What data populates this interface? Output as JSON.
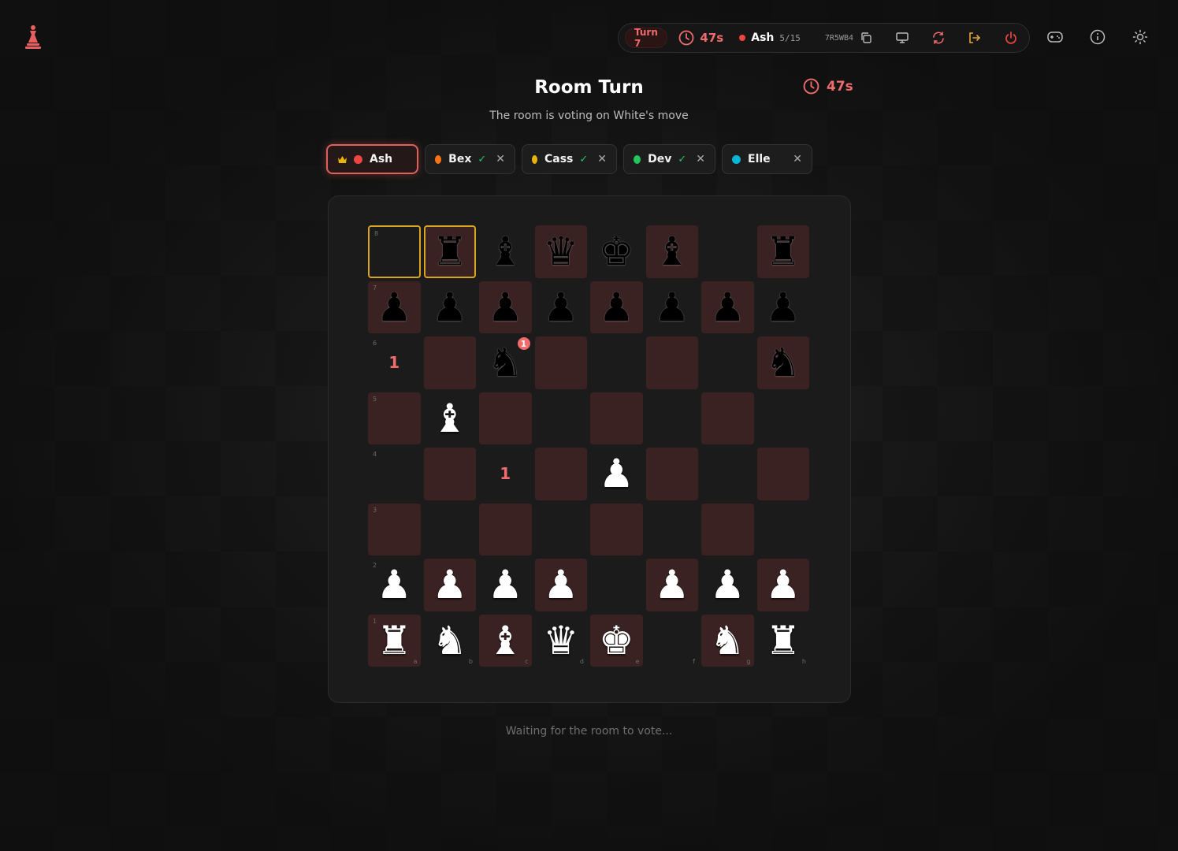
{
  "topbar": {
    "turn_label": "Turn 7",
    "timer": "47s",
    "current_player": "Ash",
    "player_count": "5/15",
    "room_code": "7R5WB4"
  },
  "header": {
    "title": "Room Turn",
    "subtitle": "The room is voting on White's move",
    "timer": "47s"
  },
  "players": [
    {
      "name": "Ash",
      "color": "#ef4444",
      "active": true,
      "leader": true,
      "voted": false,
      "removable": false
    },
    {
      "name": "Bex",
      "color": "#f97316",
      "active": false,
      "leader": false,
      "voted": true,
      "removable": true
    },
    {
      "name": "Cass",
      "color": "#eab308",
      "active": false,
      "leader": false,
      "voted": true,
      "removable": true
    },
    {
      "name": "Dev",
      "color": "#22c55e",
      "active": false,
      "leader": false,
      "voted": true,
      "removable": true
    },
    {
      "name": "Elle",
      "color": "#06b6d4",
      "active": false,
      "leader": false,
      "voted": false,
      "removable": true
    }
  ],
  "board": {
    "rank_labels": [
      "8",
      "7",
      "6",
      "5",
      "4",
      "3",
      "2",
      "1"
    ],
    "file_labels": [
      "a",
      "b",
      "c",
      "d",
      "e",
      "f",
      "g",
      "h"
    ],
    "rows": [
      [
        "",
        "r",
        "b",
        "q",
        "k",
        "b",
        "",
        "r"
      ],
      [
        "p",
        "p",
        "p",
        "p",
        "p",
        "p",
        "p",
        "p"
      ],
      [
        "",
        "",
        "n",
        "",
        "",
        "",
        "",
        "n"
      ],
      [
        "",
        "B",
        "",
        "",
        "",
        "",
        "",
        ""
      ],
      [
        "",
        "",
        "",
        "",
        "P",
        "",
        "",
        ""
      ],
      [
        "",
        "",
        "",
        "",
        "",
        "",
        "",
        ""
      ],
      [
        "P",
        "P",
        "P",
        "P",
        "",
        "P",
        "P",
        "P"
      ],
      [
        "R",
        "N",
        "B",
        "Q",
        "K",
        "",
        "N",
        "R"
      ]
    ],
    "selected": [
      "a8",
      "b8"
    ],
    "vote_markers": [
      {
        "square": "a6",
        "count": "1"
      },
      {
        "square": "c4",
        "count": "1"
      }
    ],
    "piece_badges": [
      {
        "square": "c6",
        "count": "1"
      }
    ]
  },
  "footer": {
    "status": "Waiting for the room to vote..."
  }
}
